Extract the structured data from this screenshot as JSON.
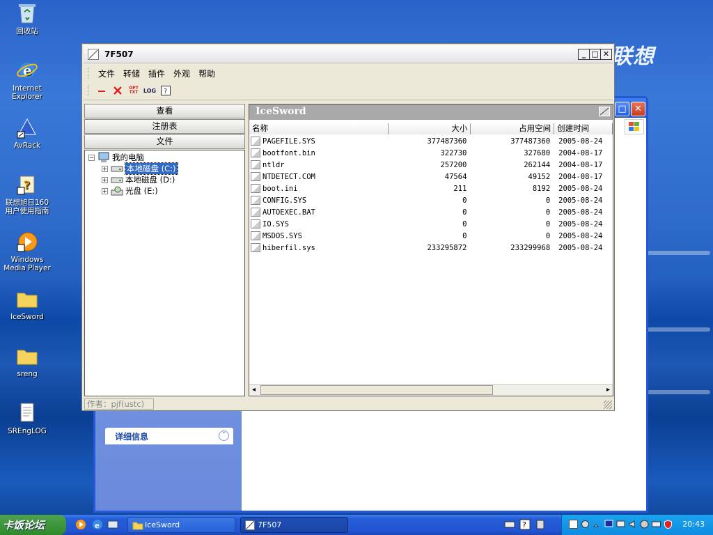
{
  "desktop": {
    "brand_text": "联想",
    "icons": [
      {
        "label_line1": "回收站",
        "label_line2": ""
      },
      {
        "label_line1": "Internet",
        "label_line2": "Explorer"
      },
      {
        "label_line1": "AvRack",
        "label_line2": ""
      },
      {
        "label_line1": "联想旭日160",
        "label_line2": "用户使用指南"
      },
      {
        "label_line1": "Windows",
        "label_line2": "Media Player"
      },
      {
        "label_line1": "IceSword",
        "label_line2": ""
      },
      {
        "label_line1": "sreng",
        "label_line2": ""
      },
      {
        "label_line1": "SREngLOG",
        "label_line2": ""
      }
    ]
  },
  "background_window": {
    "details_label": "详细信息"
  },
  "window": {
    "title": "7F507",
    "menu": [
      "文件",
      "转储",
      "插件",
      "外观",
      "帮助"
    ],
    "toolbar": {
      "log_label": "LOG",
      "txt_label": "OPT TXT"
    },
    "sidebar_buttons": [
      "查看",
      "注册表",
      "文件"
    ],
    "tree": {
      "root": "我的电脑",
      "children": [
        "本地磁盘 (C:)",
        "本地磁盘 (D:)",
        "光盘 (E:)"
      ]
    },
    "panel_title": "IceSword",
    "columns": [
      "名称",
      "大小",
      "占用空间",
      "创建时间"
    ],
    "files": [
      {
        "name": "PAGEFILE.SYS",
        "size": "377487360",
        "alloc": "377487360",
        "date": "2005-08-24"
      },
      {
        "name": "bootfont.bin",
        "size": "322730",
        "alloc": "327680",
        "date": "2004-08-17"
      },
      {
        "name": "ntldr",
        "size": "257200",
        "alloc": "262144",
        "date": "2004-08-17"
      },
      {
        "name": "NTDETECT.COM",
        "size": "47564",
        "alloc": "49152",
        "date": "2004-08-17"
      },
      {
        "name": "boot.ini",
        "size": "211",
        "alloc": "8192",
        "date": "2005-08-24"
      },
      {
        "name": "CONFIG.SYS",
        "size": "0",
        "alloc": "0",
        "date": "2005-08-24"
      },
      {
        "name": "AUTOEXEC.BAT",
        "size": "0",
        "alloc": "0",
        "date": "2005-08-24"
      },
      {
        "name": "IO.SYS",
        "size": "0",
        "alloc": "0",
        "date": "2005-08-24"
      },
      {
        "name": "MSDOS.SYS",
        "size": "0",
        "alloc": "0",
        "date": "2005-08-24"
      },
      {
        "name": "hiberfil.sys",
        "size": "233295872",
        "alloc": "233299968",
        "date": "2005-08-24"
      }
    ],
    "status": "作者：pjf(ustc)"
  },
  "taskbar": {
    "start_label": "卡饭论坛",
    "tasks": [
      "IceSword",
      "7F507"
    ],
    "clock": "20:43"
  }
}
